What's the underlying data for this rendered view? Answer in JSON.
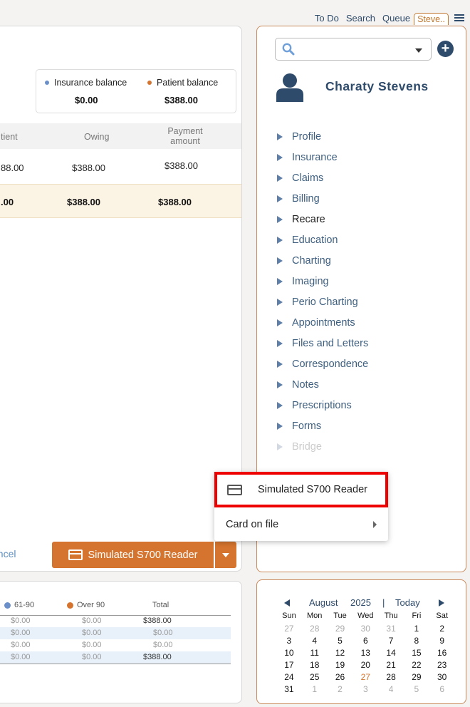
{
  "topnav": {
    "items": [
      "To Do",
      "Search",
      "Queue"
    ],
    "active_tab": "Steve.."
  },
  "balances": {
    "insurance_label": "Insurance balance",
    "insurance_value": "$0.00",
    "patient_label": "Patient balance",
    "patient_value": "$388.00",
    "insurance_color": "#6b8fc9",
    "patient_color": "#d4742e"
  },
  "table": {
    "headers": {
      "patient": "tient",
      "owing": "Owing",
      "payment_line1": "Payment",
      "payment_line2": "amount"
    },
    "row": {
      "patient": "88.00",
      "owing": "$388.00",
      "payment": "$388.00"
    },
    "total": {
      "patient": ".00",
      "owing": "$388.00",
      "payment": "$388.00"
    }
  },
  "actions": {
    "cancel_label": "ancel",
    "pay_label": "Simulated S700 Reader"
  },
  "payment_menu": {
    "selected": "Simulated S700 Reader",
    "item2": "Card on file"
  },
  "aging": {
    "headers": {
      "c61": "61-90",
      "c90": "Over 90",
      "total": "Total"
    },
    "rows": [
      [
        "$0.00",
        "$0.00",
        "$388.00"
      ],
      [
        "$0.00",
        "$0.00",
        "$0.00"
      ],
      [
        "$0.00",
        "$0.00",
        "$0.00"
      ],
      [
        "$0.00",
        "$0.00",
        "$388.00"
      ]
    ]
  },
  "patient": {
    "name": "Charaty Stevens"
  },
  "menu": [
    "Profile",
    "Insurance",
    "Claims",
    "Billing",
    "Recare",
    "Education",
    "Charting",
    "Imaging",
    "Perio Charting",
    "Appointments",
    "Files and Letters",
    "Correspondence",
    "Notes",
    "Prescriptions",
    "Forms",
    "Bridge"
  ],
  "calendar": {
    "month": "August",
    "year": "2025",
    "sep": "|",
    "today": "Today",
    "days": [
      "Sun",
      "Mon",
      "Tue",
      "Wed",
      "Thu",
      "Fri",
      "Sat"
    ],
    "weeks": [
      [
        "27",
        "28",
        "29",
        "30",
        "31",
        "1",
        "2"
      ],
      [
        "3",
        "4",
        "5",
        "6",
        "7",
        "8",
        "9"
      ],
      [
        "10",
        "11",
        "12",
        "13",
        "14",
        "15",
        "16"
      ],
      [
        "17",
        "18",
        "19",
        "20",
        "21",
        "22",
        "23"
      ],
      [
        "24",
        "25",
        "26",
        "27",
        "28",
        "29",
        "30"
      ],
      [
        "31",
        "1",
        "2",
        "3",
        "4",
        "5",
        "6"
      ]
    ],
    "today_date": "27"
  }
}
